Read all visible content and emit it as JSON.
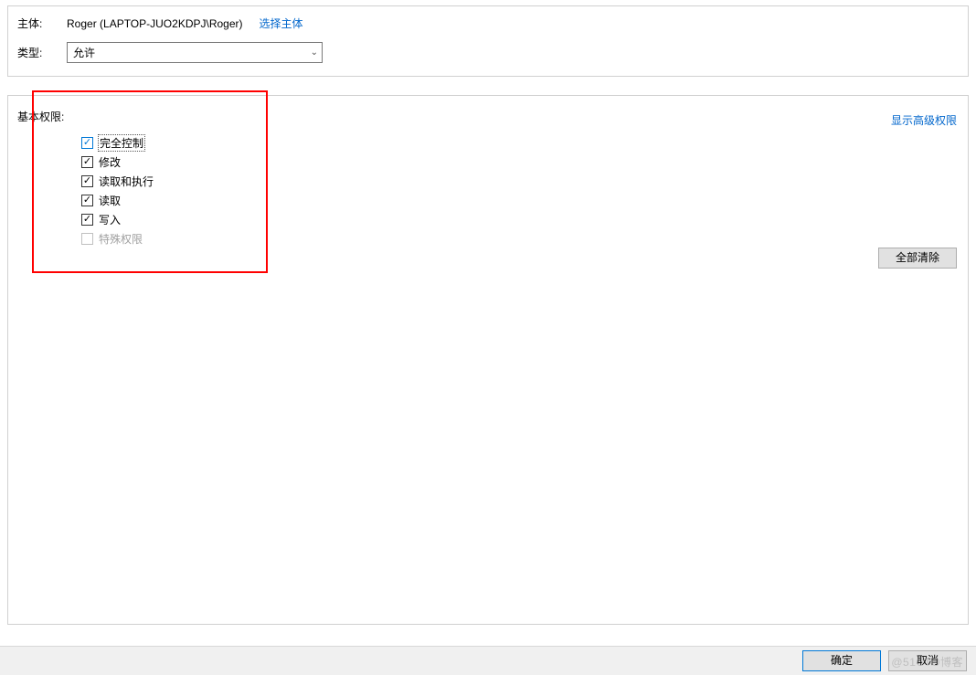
{
  "header": {
    "principal_label": "主体:",
    "principal_value": "Roger (LAPTOP-JUO2KDPJ\\Roger)",
    "select_principal_link": "选择主体",
    "type_label": "类型:",
    "type_value": "允许"
  },
  "permissions": {
    "section_label": "基本权限:",
    "advanced_link": "显示高级权限",
    "items": [
      {
        "label": "完全控制",
        "checked": true,
        "enabled": true,
        "highlighted": true,
        "focused": true
      },
      {
        "label": "修改",
        "checked": true,
        "enabled": true,
        "highlighted": false,
        "focused": false
      },
      {
        "label": "读取和执行",
        "checked": true,
        "enabled": true,
        "highlighted": false,
        "focused": false
      },
      {
        "label": "读取",
        "checked": true,
        "enabled": true,
        "highlighted": false,
        "focused": false
      },
      {
        "label": "写入",
        "checked": true,
        "enabled": true,
        "highlighted": false,
        "focused": false
      },
      {
        "label": "特殊权限",
        "checked": false,
        "enabled": false,
        "highlighted": false,
        "focused": false
      }
    ],
    "clear_all_label": "全部清除"
  },
  "footer": {
    "ok_label": "确定",
    "cancel_label": "取消"
  },
  "watermark": "@51CTO博客"
}
